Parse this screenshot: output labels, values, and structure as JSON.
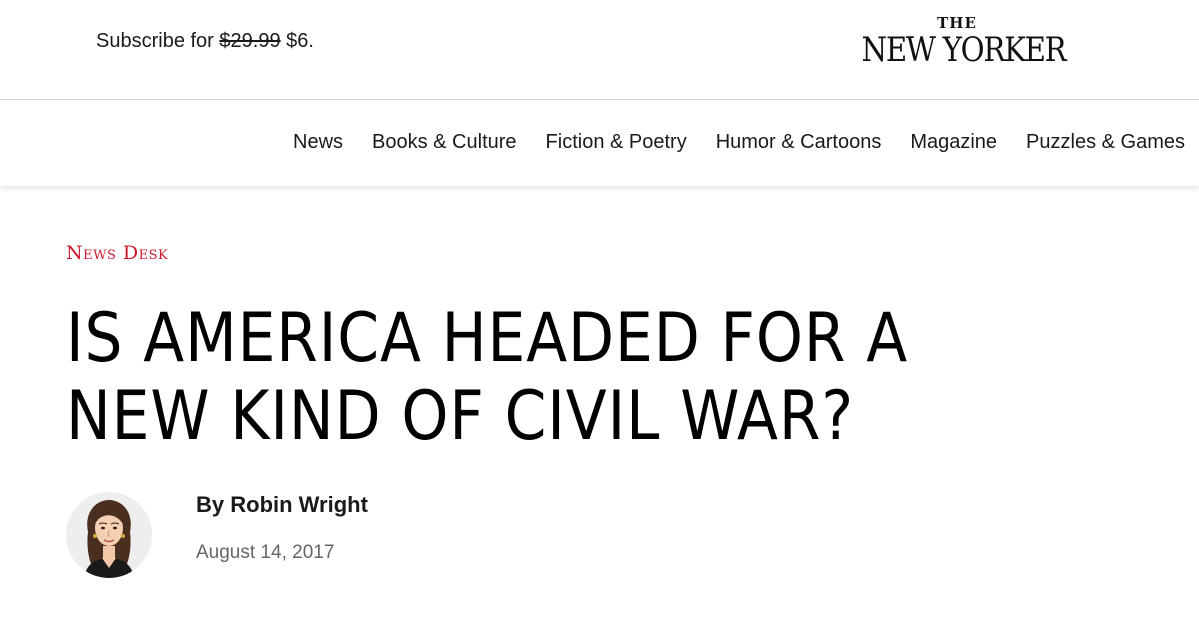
{
  "header": {
    "subscribe": {
      "label": "Subscribe for",
      "old_price": "$29.99",
      "new_price": "$6."
    },
    "logo": {
      "the": "THE",
      "name": "NEW YORKER"
    }
  },
  "nav": {
    "items": [
      {
        "label": "News"
      },
      {
        "label": "Books & Culture"
      },
      {
        "label": "Fiction & Poetry"
      },
      {
        "label": "Humor & Cartoons"
      },
      {
        "label": "Magazine"
      },
      {
        "label": "Puzzles & Games"
      }
    ]
  },
  "article": {
    "rubric": "News Desk",
    "headline_lines": [
      "Is America Headed for a",
      "New Kind of Civil War?"
    ],
    "byline_prefix": "By",
    "author": "Robin Wright",
    "date": "August 14, 2017"
  },
  "colors": {
    "rubric": "#c8192b",
    "date": "#666666",
    "divider": "#d9d9d9"
  }
}
